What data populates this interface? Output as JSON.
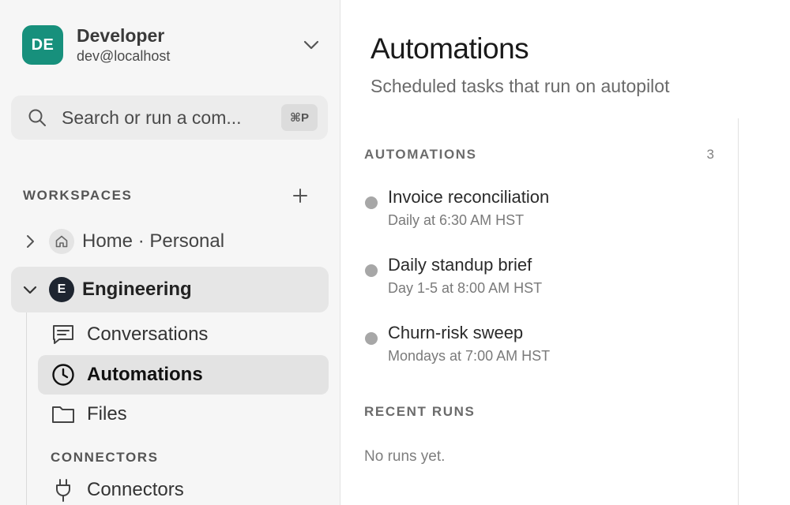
{
  "user": {
    "initials": "DE",
    "name": "Developer",
    "email": "dev@localhost"
  },
  "search": {
    "placeholder": "Search or run a com...",
    "shortcut": "⌘P"
  },
  "sidebar": {
    "workspaces_label": "WORKSPACES",
    "workspaces": [
      {
        "name": "Home · Personal",
        "icon": "home-icon",
        "expanded": false
      },
      {
        "name": "Engineering",
        "badge": "E",
        "expanded": true
      }
    ],
    "nav": [
      {
        "label": "Conversations",
        "icon": "chat-icon"
      },
      {
        "label": "Automations",
        "icon": "clock-icon",
        "active": true
      },
      {
        "label": "Files",
        "icon": "folder-icon"
      }
    ],
    "connectors_label": "CONNECTORS",
    "connectors_item": {
      "label": "Connectors",
      "icon": "plug-icon"
    }
  },
  "main": {
    "title": "Automations",
    "subtitle": "Scheduled tasks that run on autopilot",
    "automations_heading": "AUTOMATIONS",
    "automations_count": "3",
    "automations": [
      {
        "name": "Invoice reconciliation",
        "schedule": "Daily at 6:30 AM HST"
      },
      {
        "name": "Daily standup brief",
        "schedule": "Day 1-5 at 8:00 AM HST"
      },
      {
        "name": "Churn-risk sweep",
        "schedule": "Mondays at 7:00 AM HST"
      }
    ],
    "recent_runs_heading": "RECENT RUNS",
    "recent_runs_empty": "No runs yet."
  },
  "colors": {
    "avatar": "#17907c",
    "active_bg": "#e3e3e3",
    "status_dot": "#a7a7a7",
    "workspace_badge": "#1e2530"
  }
}
